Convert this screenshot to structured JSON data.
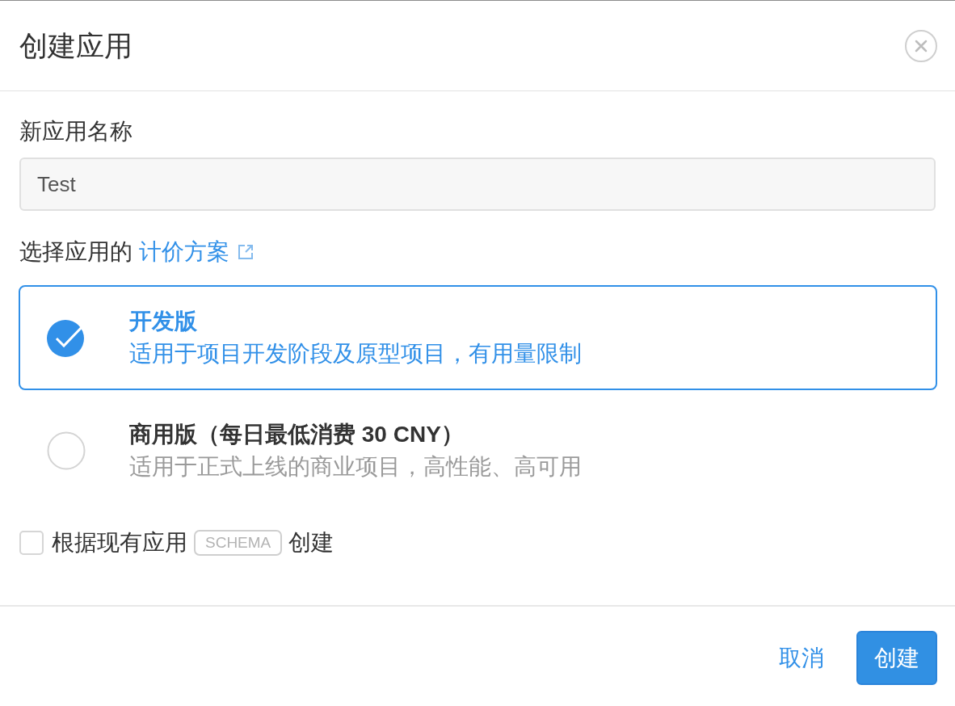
{
  "dialog": {
    "title": "创建应用"
  },
  "name_field": {
    "label": "新应用名称",
    "value": "Test"
  },
  "plan_prompt": {
    "text": "选择应用的",
    "link": "计价方案"
  },
  "plans": [
    {
      "title": "开发版",
      "description": "适用于项目开发阶段及原型项目，有用量限制",
      "selected": true
    },
    {
      "title": "商用版（每日最低消费 30 CNY）",
      "description": "适用于正式上线的商业项目，高性能、高可用",
      "selected": false
    }
  ],
  "schema_option": {
    "checked": false,
    "text_before": "根据现有应用",
    "tag": "SCHEMA",
    "text_after": "创建"
  },
  "buttons": [
    {
      "label": "取消",
      "kind": "link"
    },
    {
      "label": "创建",
      "kind": "primary"
    }
  ]
}
